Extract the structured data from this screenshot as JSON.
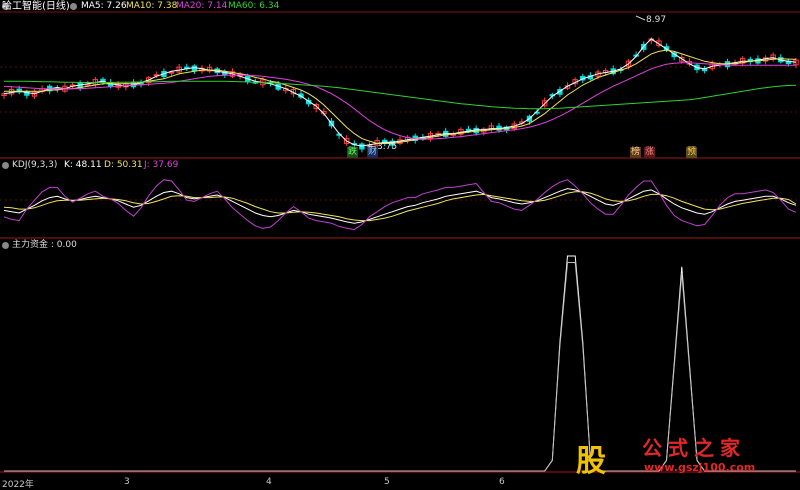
{
  "header": {
    "title": "哈工智能(日线)",
    "ma": [
      {
        "label": "MA5: 7.26",
        "color": "#ffffff"
      },
      {
        "label": "MA10: 7.38",
        "color": "#f2e25c"
      },
      {
        "label": "MA20: 7.14",
        "color": "#e040e0"
      },
      {
        "label": "MA60: 6.34",
        "color": "#30d030"
      }
    ]
  },
  "kdj_header": {
    "name": "KDJ(9,3,3)",
    "k": "K: 48.11",
    "d": "D: 50.31",
    "j": "J: 37.69"
  },
  "flow_header": {
    "label": "主力资金 : 0.00"
  },
  "annotations": {
    "low_price": "3.75",
    "high_price": "8.97",
    "tags": [
      "跌",
      "财",
      "榜",
      "涨",
      "预"
    ]
  },
  "x_axis": {
    "ticks": [
      "2022年",
      "3",
      "4",
      "5",
      "6"
    ]
  },
  "watermark": {
    "glyph": "股",
    "title": "公式之家",
    "url": "www.gszj100.com"
  },
  "colors": {
    "background": "#000000",
    "up": "#ff3c3c",
    "down": "#00e0e0",
    "grid": "#7a1010",
    "panel_border": "#a01818"
  },
  "chart_data": [
    {
      "type": "line",
      "title": "哈工智能(日线)",
      "note": "candlestick price chart with moving averages",
      "categories_count": 130,
      "ylim": [
        3.5,
        9.2
      ],
      "series": [
        {
          "name": "MA5",
          "values": [
            6.0,
            6.05,
            6.1,
            6.05,
            6.0,
            6.1,
            6.2,
            6.25,
            6.2,
            6.3,
            6.35,
            6.4,
            6.45,
            6.5,
            6.4,
            6.35,
            6.3,
            6.35,
            6.45,
            6.55,
            6.7,
            6.8,
            6.9,
            6.95,
            7.0,
            7.05,
            7.0,
            6.95,
            6.9,
            6.85,
            6.8,
            6.7,
            6.6,
            6.5,
            6.45,
            6.4,
            6.3,
            6.2,
            6.05,
            5.9,
            5.7,
            5.5,
            5.2,
            4.8,
            4.4,
            4.1,
            3.95,
            3.9,
            3.95,
            4.0,
            4.05,
            4.05,
            4.1,
            4.15,
            4.2,
            4.25,
            4.3,
            4.35,
            4.4,
            4.4,
            4.45,
            4.5,
            4.55,
            4.55,
            4.6,
            4.6,
            4.65,
            4.7,
            4.8,
            5.0,
            5.3,
            5.6,
            5.9,
            6.1,
            6.3,
            6.45,
            6.6,
            6.7,
            6.8,
            6.85,
            6.9,
            7.0,
            7.2,
            7.5,
            7.9,
            8.2,
            8.0,
            7.8,
            7.6,
            7.4,
            7.2,
            7.05,
            7.0,
            7.1,
            7.15,
            7.2,
            7.25,
            7.3,
            7.3,
            7.35,
            7.4,
            7.45,
            7.35,
            7.3,
            7.26
          ]
        },
        {
          "name": "MA10",
          "values": [
            6.1,
            6.1,
            6.1,
            6.1,
            6.1,
            6.1,
            6.15,
            6.15,
            6.2,
            6.2,
            6.25,
            6.3,
            6.35,
            6.4,
            6.4,
            6.4,
            6.4,
            6.4,
            6.45,
            6.5,
            6.55,
            6.6,
            6.7,
            6.8,
            6.85,
            6.9,
            6.95,
            6.95,
            6.95,
            6.9,
            6.85,
            6.8,
            6.75,
            6.65,
            6.6,
            6.5,
            6.45,
            6.35,
            6.25,
            6.15,
            6.0,
            5.8,
            5.55,
            5.25,
            4.95,
            4.65,
            4.4,
            4.2,
            4.1,
            4.0,
            4.0,
            4.0,
            4.05,
            4.1,
            4.15,
            4.2,
            4.25,
            4.3,
            4.35,
            4.38,
            4.42,
            4.46,
            4.5,
            4.52,
            4.55,
            4.58,
            4.6,
            4.65,
            4.7,
            4.8,
            5.0,
            5.2,
            5.45,
            5.7,
            5.95,
            6.15,
            6.35,
            6.5,
            6.65,
            6.75,
            6.85,
            6.95,
            7.05,
            7.2,
            7.4,
            7.6,
            7.7,
            7.75,
            7.7,
            7.6,
            7.5,
            7.4,
            7.3,
            7.25,
            7.2,
            7.2,
            7.2,
            7.25,
            7.3,
            7.32,
            7.35,
            7.38,
            7.4,
            7.39,
            7.38
          ]
        },
        {
          "name": "MA20",
          "values": [
            6.3,
            6.28,
            6.26,
            6.24,
            6.22,
            6.2,
            6.2,
            6.2,
            6.2,
            6.2,
            6.2,
            6.22,
            6.24,
            6.26,
            6.28,
            6.3,
            6.32,
            6.34,
            6.36,
            6.38,
            6.4,
            6.42,
            6.45,
            6.5,
            6.55,
            6.6,
            6.65,
            6.7,
            6.72,
            6.74,
            6.75,
            6.75,
            6.74,
            6.72,
            6.7,
            6.66,
            6.62,
            6.58,
            6.52,
            6.46,
            6.38,
            6.28,
            6.15,
            6.0,
            5.82,
            5.62,
            5.4,
            5.15,
            4.92,
            4.72,
            4.55,
            4.42,
            4.32,
            4.24,
            4.2,
            4.18,
            4.18,
            4.2,
            4.22,
            4.25,
            4.28,
            4.32,
            4.36,
            4.4,
            4.44,
            4.48,
            4.52,
            4.55,
            4.6,
            4.66,
            4.74,
            4.84,
            4.96,
            5.1,
            5.26,
            5.44,
            5.62,
            5.8,
            5.98,
            6.14,
            6.3,
            6.44,
            6.58,
            6.72,
            6.86,
            7.0,
            7.1,
            7.18,
            7.22,
            7.24,
            7.24,
            7.22,
            7.2,
            7.18,
            7.16,
            7.15,
            7.14,
            7.14,
            7.14,
            7.14,
            7.14,
            7.14,
            7.14,
            7.14,
            7.14
          ]
        },
        {
          "name": "MA60",
          "values": [
            6.5,
            6.5,
            6.5,
            6.5,
            6.49,
            6.48,
            6.48,
            6.47,
            6.46,
            6.46,
            6.45,
            6.45,
            6.45,
            6.45,
            6.45,
            6.46,
            6.46,
            6.47,
            6.47,
            6.48,
            6.48,
            6.49,
            6.5,
            6.5,
            6.5,
            6.5,
            6.5,
            6.5,
            6.5,
            6.5,
            6.49,
            6.48,
            6.47,
            6.46,
            6.45,
            6.44,
            6.42,
            6.4,
            6.38,
            6.36,
            6.34,
            6.32,
            6.3,
            6.27,
            6.24,
            6.2,
            6.16,
            6.12,
            6.08,
            6.04,
            6.0,
            5.96,
            5.92,
            5.88,
            5.84,
            5.8,
            5.76,
            5.72,
            5.68,
            5.64,
            5.6,
            5.57,
            5.54,
            5.51,
            5.48,
            5.46,
            5.44,
            5.42,
            5.41,
            5.4,
            5.4,
            5.4,
            5.41,
            5.42,
            5.44,
            5.46,
            5.48,
            5.5,
            5.52,
            5.54,
            5.56,
            5.58,
            5.6,
            5.62,
            5.64,
            5.66,
            5.68,
            5.7,
            5.72,
            5.74,
            5.76,
            5.8,
            5.85,
            5.9,
            5.95,
            6.0,
            6.05,
            6.1,
            6.15,
            6.2,
            6.24,
            6.28,
            6.31,
            6.33,
            6.34
          ]
        }
      ]
    },
    {
      "type": "line",
      "title": "KDJ(9,3,3)",
      "ylim": [
        0,
        100
      ],
      "series": [
        {
          "name": "K",
          "values": [
            40,
            38,
            36,
            42,
            48,
            55,
            60,
            62,
            58,
            55,
            57,
            60,
            62,
            60,
            58,
            55,
            50,
            45,
            48,
            55,
            62,
            68,
            70,
            66,
            60,
            58,
            60,
            62,
            64,
            60,
            54,
            48,
            42,
            36,
            32,
            30,
            32,
            36,
            40,
            38,
            34,
            32,
            30,
            28,
            25,
            22,
            20,
            22,
            26,
            30,
            34,
            38,
            42,
            46,
            48,
            52,
            55,
            58,
            62,
            64,
            66,
            68,
            70,
            66,
            60,
            58,
            55,
            52,
            50,
            52,
            55,
            60,
            65,
            70,
            74,
            72,
            68,
            62,
            56,
            50,
            48,
            52,
            58,
            64,
            70,
            72,
            66,
            58,
            50,
            44,
            40,
            36,
            34,
            38,
            44,
            50,
            54,
            56,
            58,
            60,
            62,
            62,
            58,
            52,
            48
          ]
        },
        {
          "name": "D",
          "values": [
            45,
            44,
            42,
            42,
            44,
            48,
            52,
            55,
            56,
            56,
            56,
            57,
            58,
            59,
            58,
            57,
            55,
            52,
            50,
            51,
            54,
            58,
            62,
            63,
            62,
            60,
            60,
            60,
            61,
            61,
            59,
            55,
            51,
            46,
            42,
            38,
            36,
            36,
            37,
            38,
            37,
            36,
            34,
            32,
            30,
            27,
            25,
            24,
            24,
            26,
            28,
            31,
            35,
            39,
            42,
            45,
            48,
            51,
            55,
            58,
            60,
            62,
            64,
            65,
            63,
            61,
            59,
            57,
            55,
            54,
            54,
            56,
            59,
            63,
            67,
            69,
            69,
            67,
            63,
            58,
            55,
            54,
            55,
            58,
            62,
            65,
            65,
            63,
            59,
            54,
            50,
            46,
            42,
            41,
            42,
            45,
            48,
            51,
            53,
            55,
            57,
            59,
            59,
            57,
            50
          ]
        },
        {
          "name": "J",
          "values": [
            30,
            26,
            24,
            42,
            56,
            69,
            76,
            76,
            62,
            53,
            59,
            66,
            70,
            62,
            58,
            51,
            40,
            31,
            44,
            63,
            78,
            88,
            86,
            72,
            56,
            54,
            60,
            66,
            70,
            58,
            44,
            34,
            24,
            16,
            12,
            14,
            24,
            36,
            46,
            38,
            28,
            24,
            22,
            20,
            15,
            12,
            10,
            18,
            30,
            38,
            46,
            52,
            56,
            60,
            60,
            66,
            69,
            72,
            76,
            76,
            78,
            80,
            82,
            68,
            54,
            52,
            47,
            42,
            40,
            48,
            57,
            68,
            77,
            84,
            88,
            78,
            66,
            52,
            42,
            34,
            34,
            48,
            64,
            76,
            86,
            86,
            68,
            48,
            32,
            24,
            20,
            16,
            18,
            32,
            48,
            60,
            66,
            66,
            68,
            70,
            72,
            68,
            56,
            42,
            37
          ]
        }
      ]
    },
    {
      "type": "line",
      "title": "主力资金",
      "ylim": [
        0,
        1
      ],
      "series": [
        {
          "name": "主力资金",
          "values": [
            0,
            0,
            0,
            0,
            0,
            0,
            0,
            0,
            0,
            0,
            0,
            0,
            0,
            0,
            0,
            0,
            0,
            0,
            0,
            0,
            0,
            0,
            0,
            0,
            0,
            0,
            0,
            0,
            0,
            0,
            0,
            0,
            0,
            0,
            0,
            0,
            0,
            0,
            0,
            0,
            0,
            0,
            0,
            0,
            0,
            0,
            0,
            0,
            0,
            0,
            0,
            0,
            0,
            0,
            0,
            0,
            0,
            0,
            0,
            0,
            0,
            0,
            0,
            0,
            0,
            0,
            0,
            0,
            0,
            0,
            0,
            0,
            0.05,
            0.6,
            1,
            1,
            0.6,
            0.05,
            0,
            0,
            0,
            0,
            0,
            0,
            0,
            0,
            0,
            0.05,
            0.5,
            0.95,
            0.5,
            0.05,
            0,
            0,
            0,
            0,
            0,
            0,
            0,
            0,
            0,
            0,
            0,
            0,
            0
          ]
        }
      ]
    }
  ]
}
